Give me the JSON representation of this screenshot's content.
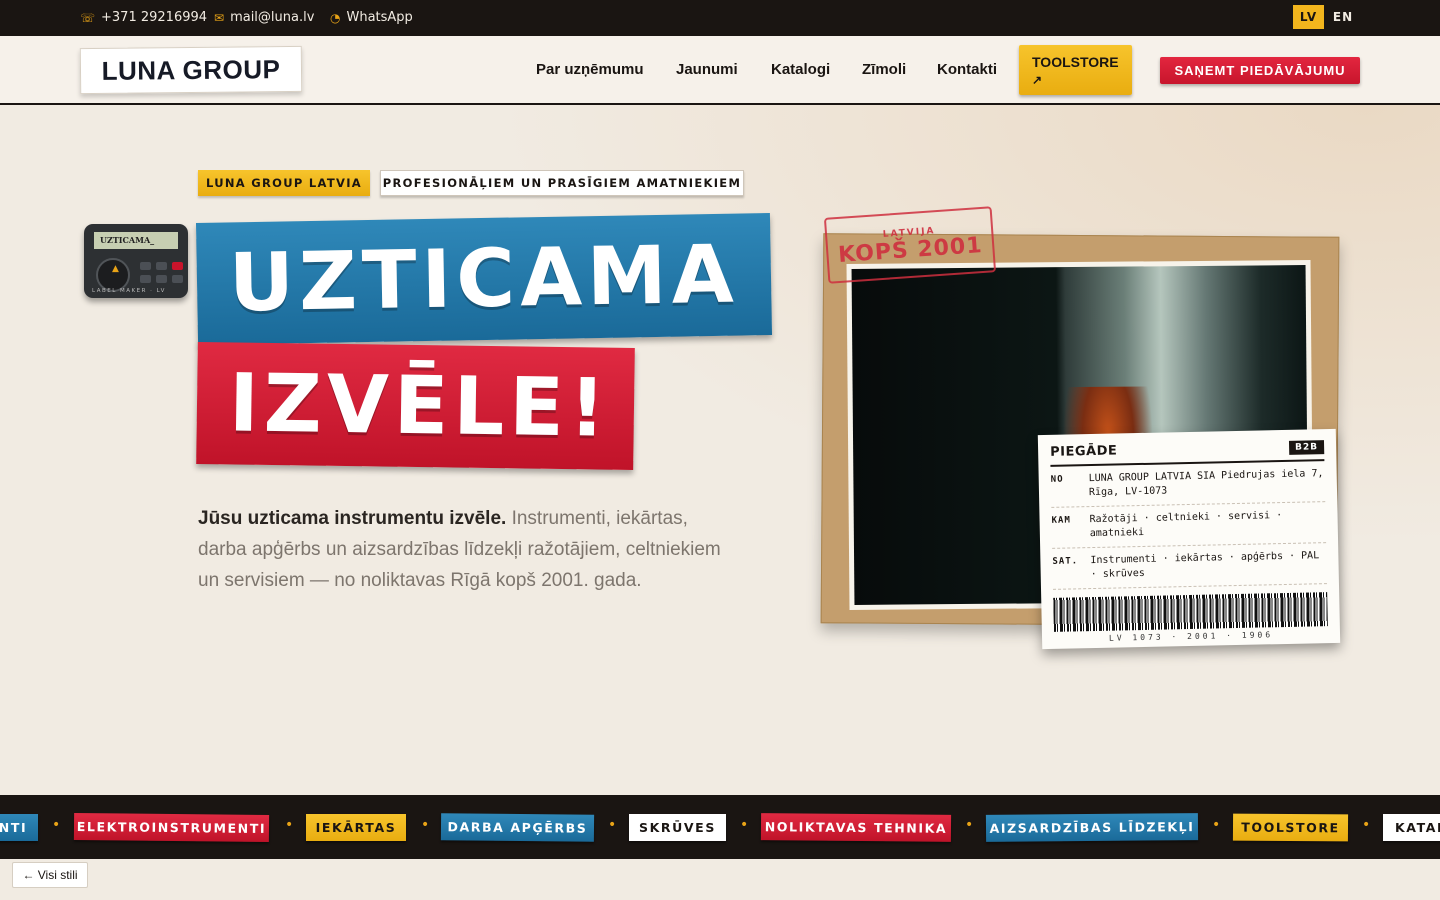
{
  "topbar": {
    "phone": "+371 29216994",
    "email": "mail@luna.lv",
    "whatsapp": "WhatsApp",
    "lang_lv": "LV",
    "lang_en": "EN"
  },
  "header": {
    "logo": "LUNA GROUP",
    "nav": [
      "Par uzņēmumu",
      "Jaunumi",
      "Katalogi",
      "Zīmoli",
      "Kontakti"
    ],
    "toolstore_label": "TOOLSTORE",
    "toolstore_arrow": "↗",
    "quote_label": "SAŅEMT PIEDĀVĀJUMU"
  },
  "hero": {
    "tag_primary": "LUNA GROUP LATVIA",
    "tag_secondary": "PROFESIONĀĻIEM UN PRASĪGIEM AMATNIEKIEM",
    "label_maker_screen": "UZTICAMA_",
    "label_maker_brand": "LABEL MAKER · LV",
    "title_line1": "UZTICAMA",
    "title_line2": "IZVĒLE!",
    "intro_bold": "Jūsu uzticama instrumentu izvēle.",
    "intro_rest": " Instrumenti, iekārtas, darba apģērbs un aizsardzības līdzekļi ražotājiem, celtniekiem un servisiem — no noliktavas Rīgā kopš 2001. gada."
  },
  "stamp": {
    "small": "LATVIJA",
    "big": "KOPŠ 2001"
  },
  "shipping_label": {
    "title": "PIEGĀDE",
    "badge": "B2B",
    "rows": [
      {
        "key": "NO",
        "value": "LUNA GROUP LATVIA SIA Piedrujas iela 7, Rīga, LV-1073"
      },
      {
        "key": "KAM",
        "value": "Ražotāji · celtnieki · servisi · amatnieki"
      },
      {
        "key": "SAT.",
        "value": "Instrumenti · iekārtas · apģērbs · PAL · skrūves"
      }
    ],
    "barcode_text": "LV 1073 · 2001 · 1906"
  },
  "ticker": {
    "items": [
      "NTI",
      "ELEKTROINSTRUMENTI",
      "IEKĀRTAS",
      "DARBA APĢĒRBS",
      "SKRŪVES",
      "NOLIKTAVAS TEHNIKA",
      "AIZSARDZĪBAS LĪDZEKĻI",
      "TOOLSTORE",
      "KATAL"
    ],
    "separator": "•"
  },
  "footer": {
    "back_label": "← Visi stili"
  },
  "colors": {
    "accent_yellow": "#f2b51d",
    "accent_red": "#d31d35",
    "accent_blue": "#23789f",
    "dark": "#1a1512"
  }
}
